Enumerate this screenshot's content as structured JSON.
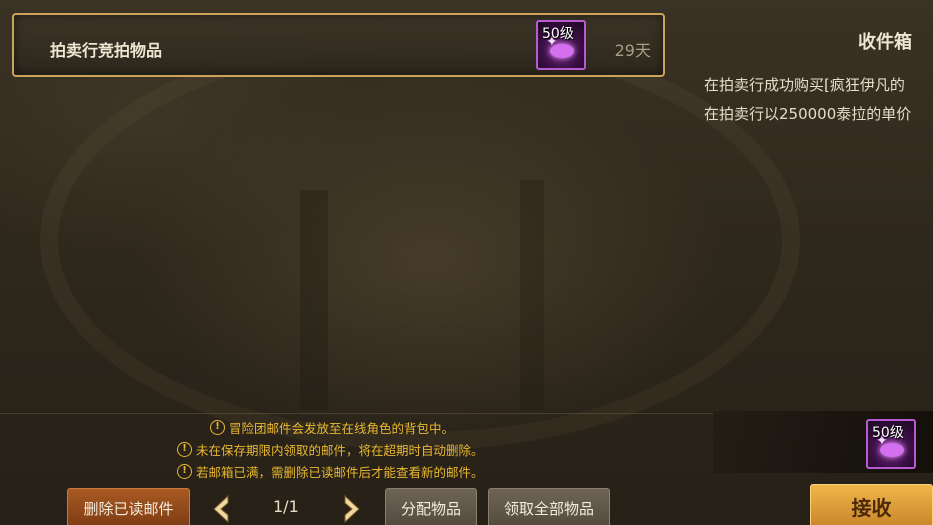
{
  "mail_list": {
    "items": [
      {
        "title": "拍卖行竞拍物品",
        "days_left": "29天",
        "attachment": {
          "level": "50级"
        }
      }
    ]
  },
  "detail": {
    "header": "收件箱",
    "line1": "在拍卖行成功购买[疯狂伊凡的",
    "line2": "在拍卖行以250000泰拉的单价",
    "attachment": {
      "level": "50级"
    }
  },
  "notices": [
    "冒险团邮件会发放至在线角色的背包中。",
    "未在保存期限内领取的邮件，将在超期时自动删除。",
    "若邮箱已满，需删除已读邮件后才能查看新的邮件。"
  ],
  "toolbar": {
    "delete_read_label": "删除已读邮件",
    "page_indicator": "1/1",
    "distribute_label": "分配物品",
    "claim_all_label": "领取全部物品",
    "receive_label": "接收"
  },
  "colors": {
    "accent_gold": "#c9a45a",
    "notice_yellow": "#e8b830",
    "delete_orange": "#a85a22",
    "receive_gold": "#f0b64a",
    "item_purple": "#b85ad0"
  }
}
